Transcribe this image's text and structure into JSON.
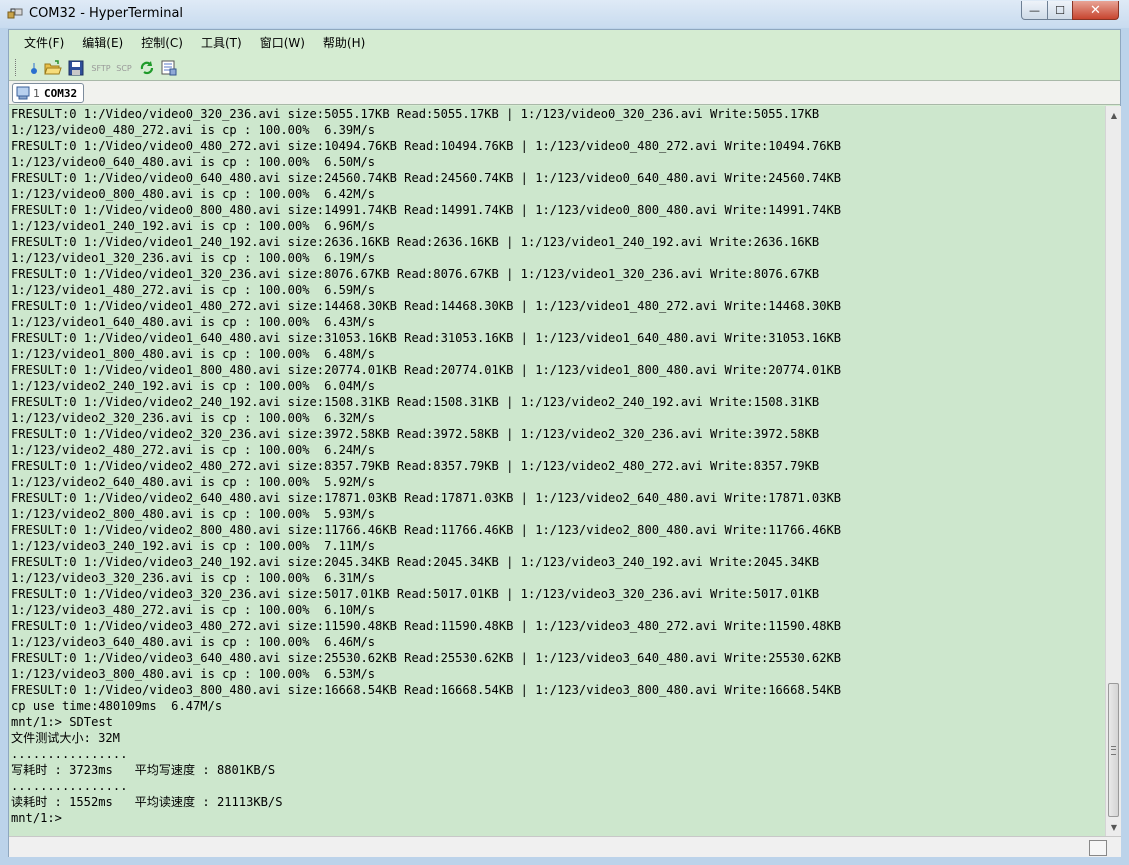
{
  "window": {
    "title": "COM32 - HyperTerminal",
    "controls": {
      "minimize": "—",
      "maximize": "☐",
      "close": "✕"
    }
  },
  "menu": [
    "文件(F)",
    "编辑(E)",
    "控制(C)",
    "工具(T)",
    "窗口(W)",
    "帮助(H)"
  ],
  "toolbar": {
    "buttons": [
      {
        "name": "new-connection",
        "icon": "drop-icon"
      },
      {
        "name": "open",
        "icon": "folder-open-icon"
      },
      {
        "name": "save",
        "icon": "floppy-disk-icon"
      },
      {
        "name": "sftp",
        "label": "SFTP"
      },
      {
        "name": "scp",
        "label": "SCP"
      },
      {
        "name": "reconnect",
        "icon": "refresh-icon"
      },
      {
        "name": "properties",
        "icon": "settings-sheet-icon"
      }
    ]
  },
  "tab": {
    "number": "1",
    "name": "COM32"
  },
  "terminal": {
    "lines": [
      "FRESULT:0 1:/Video/video0_320_236.avi size:5055.17KB Read:5055.17KB | 1:/123/video0_320_236.avi Write:5055.17KB",
      "1:/123/video0_480_272.avi is cp : 100.00%  6.39M/s",
      "FRESULT:0 1:/Video/video0_480_272.avi size:10494.76KB Read:10494.76KB | 1:/123/video0_480_272.avi Write:10494.76KB",
      "1:/123/video0_640_480.avi is cp : 100.00%  6.50M/s",
      "FRESULT:0 1:/Video/video0_640_480.avi size:24560.74KB Read:24560.74KB | 1:/123/video0_640_480.avi Write:24560.74KB",
      "1:/123/video0_800_480.avi is cp : 100.00%  6.42M/s",
      "FRESULT:0 1:/Video/video0_800_480.avi size:14991.74KB Read:14991.74KB | 1:/123/video0_800_480.avi Write:14991.74KB",
      "1:/123/video1_240_192.avi is cp : 100.00%  6.96M/s",
      "FRESULT:0 1:/Video/video1_240_192.avi size:2636.16KB Read:2636.16KB | 1:/123/video1_240_192.avi Write:2636.16KB",
      "1:/123/video1_320_236.avi is cp : 100.00%  6.19M/s",
      "FRESULT:0 1:/Video/video1_320_236.avi size:8076.67KB Read:8076.67KB | 1:/123/video1_320_236.avi Write:8076.67KB",
      "1:/123/video1_480_272.avi is cp : 100.00%  6.59M/s",
      "FRESULT:0 1:/Video/video1_480_272.avi size:14468.30KB Read:14468.30KB | 1:/123/video1_480_272.avi Write:14468.30KB",
      "1:/123/video1_640_480.avi is cp : 100.00%  6.43M/s",
      "FRESULT:0 1:/Video/video1_640_480.avi size:31053.16KB Read:31053.16KB | 1:/123/video1_640_480.avi Write:31053.16KB",
      "1:/123/video1_800_480.avi is cp : 100.00%  6.48M/s",
      "FRESULT:0 1:/Video/video1_800_480.avi size:20774.01KB Read:20774.01KB | 1:/123/video1_800_480.avi Write:20774.01KB",
      "1:/123/video2_240_192.avi is cp : 100.00%  6.04M/s",
      "FRESULT:0 1:/Video/video2_240_192.avi size:1508.31KB Read:1508.31KB | 1:/123/video2_240_192.avi Write:1508.31KB",
      "1:/123/video2_320_236.avi is cp : 100.00%  6.32M/s",
      "FRESULT:0 1:/Video/video2_320_236.avi size:3972.58KB Read:3972.58KB | 1:/123/video2_320_236.avi Write:3972.58KB",
      "1:/123/video2_480_272.avi is cp : 100.00%  6.24M/s",
      "FRESULT:0 1:/Video/video2_480_272.avi size:8357.79KB Read:8357.79KB | 1:/123/video2_480_272.avi Write:8357.79KB",
      "1:/123/video2_640_480.avi is cp : 100.00%  5.92M/s",
      "FRESULT:0 1:/Video/video2_640_480.avi size:17871.03KB Read:17871.03KB | 1:/123/video2_640_480.avi Write:17871.03KB",
      "1:/123/video2_800_480.avi is cp : 100.00%  5.93M/s",
      "FRESULT:0 1:/Video/video2_800_480.avi size:11766.46KB Read:11766.46KB | 1:/123/video2_800_480.avi Write:11766.46KB",
      "1:/123/video3_240_192.avi is cp : 100.00%  7.11M/s",
      "FRESULT:0 1:/Video/video3_240_192.avi size:2045.34KB Read:2045.34KB | 1:/123/video3_240_192.avi Write:2045.34KB",
      "1:/123/video3_320_236.avi is cp : 100.00%  6.31M/s",
      "FRESULT:0 1:/Video/video3_320_236.avi size:5017.01KB Read:5017.01KB | 1:/123/video3_320_236.avi Write:5017.01KB",
      "1:/123/video3_480_272.avi is cp : 100.00%  6.10M/s",
      "FRESULT:0 1:/Video/video3_480_272.avi size:11590.48KB Read:11590.48KB | 1:/123/video3_480_272.avi Write:11590.48KB",
      "1:/123/video3_640_480.avi is cp : 100.00%  6.46M/s",
      "FRESULT:0 1:/Video/video3_640_480.avi size:25530.62KB Read:25530.62KB | 1:/123/video3_640_480.avi Write:25530.62KB",
      "1:/123/video3_800_480.avi is cp : 100.00%  6.53M/s",
      "FRESULT:0 1:/Video/video3_800_480.avi size:16668.54KB Read:16668.54KB | 1:/123/video3_800_480.avi Write:16668.54KB",
      "cp use time:480109ms  6.47M/s",
      "mnt/1:> SDTest",
      "文件测试大小: 32M",
      "................",
      "写耗时 : 3723ms   平均写速度 : 8801KB/S",
      "................",
      "读耗时 : 1552ms   平均读速度 : 21113KB/S",
      "mnt/1:>"
    ]
  },
  "colors": {
    "terminal_bg": "#cde7cd",
    "window_frame": "#bcd3ea",
    "close_button": "#c7452f"
  }
}
